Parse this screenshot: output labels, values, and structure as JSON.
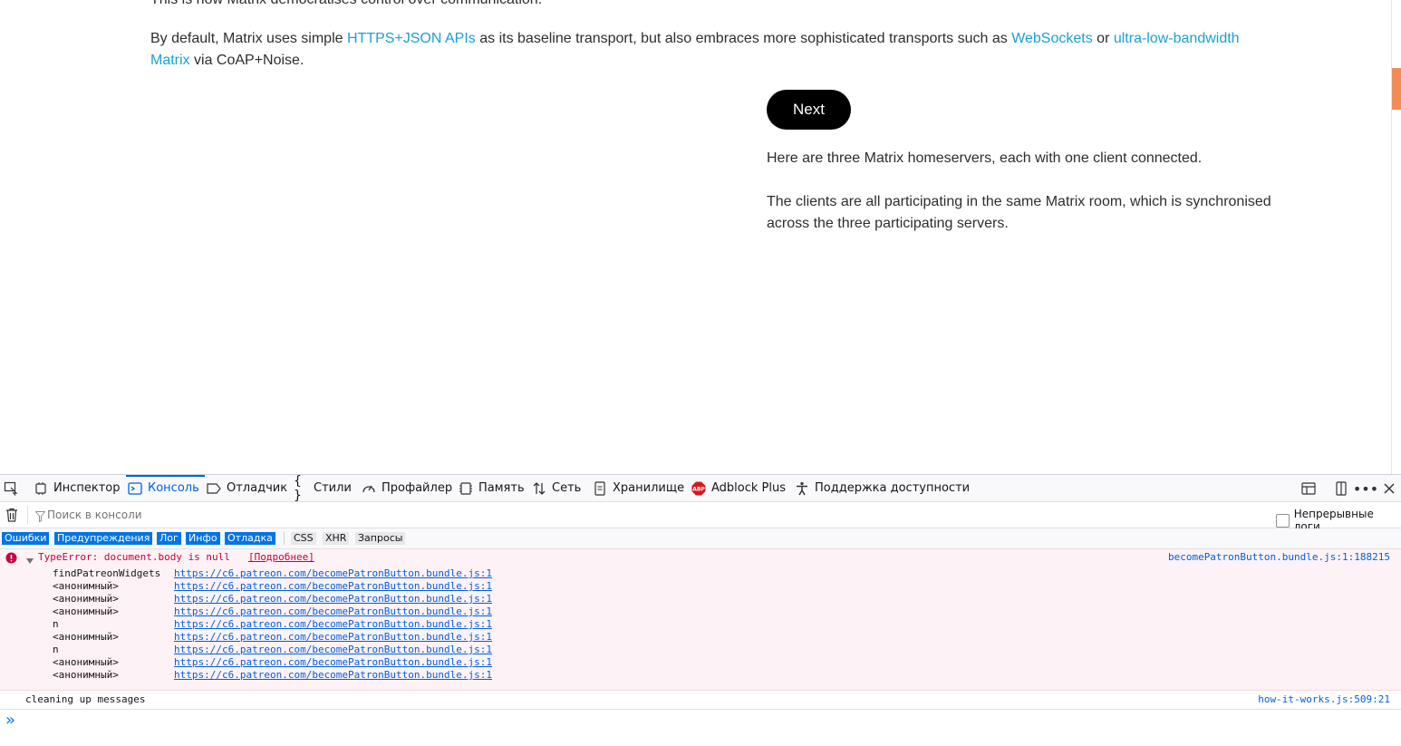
{
  "page": {
    "top_text": "This is how Matrix democratises control over communication.",
    "para1": {
      "t1": "By default, Matrix uses simple ",
      "l1": "HTTPS+JSON APIs",
      "t2": " as its baseline transport, but also embraces more sophisticated transports such as ",
      "l2": "WebSockets",
      "t3": " or ",
      "l3a": "ultra-low-bandwidth",
      "l3b": "Matrix",
      "t4": " via CoAP+Noise."
    },
    "next_label": "Next",
    "desc1": "Here are three Matrix homeservers, each with one client connected.",
    "desc2a": "The clients are all participating in the same Matrix room, which is synchronised",
    "desc2b": "across the three participating servers."
  },
  "devtools": {
    "tabs": [
      {
        "label": "Инспектор",
        "icon": "inspector-icon"
      },
      {
        "label": "Консоль",
        "icon": "console-icon"
      },
      {
        "label": "Отладчик",
        "icon": "debugger-icon"
      },
      {
        "label": "Стили",
        "icon": "styles-icon"
      },
      {
        "label": "Профайлер",
        "icon": "profiler-icon"
      },
      {
        "label": "Память",
        "icon": "memory-icon"
      },
      {
        "label": "Сеть",
        "icon": "network-icon"
      },
      {
        "label": "Хранилище",
        "icon": "storage-icon"
      },
      {
        "label": "Adblock Plus",
        "icon": "adblock-icon"
      },
      {
        "label": "Поддержка доступности",
        "icon": "accessibility-icon"
      }
    ],
    "filter_placeholder": "Поиск в консоли",
    "persist_logs_label": "Непрерывные логи",
    "levels": [
      "Ошибки",
      "Предупреждения",
      "Лог",
      "Инфо",
      "Отладка"
    ],
    "extra_filters": [
      "CSS",
      "XHR",
      "Запросы"
    ],
    "error": {
      "message": "TypeError: document.body is null",
      "more": "[Подробнее]",
      "source": "becomePatronButton.bundle.js:1:188215",
      "stack": [
        {
          "fn": "findPatreonWidgets",
          "url": "https://c6.patreon.com/becomePatronButton.bundle.js:1"
        },
        {
          "fn": "<анонимный>",
          "url": "https://c6.patreon.com/becomePatronButton.bundle.js:1"
        },
        {
          "fn": "<анонимный>",
          "url": "https://c6.patreon.com/becomePatronButton.bundle.js:1"
        },
        {
          "fn": "<анонимный>",
          "url": "https://c6.patreon.com/becomePatronButton.bundle.js:1"
        },
        {
          "fn": "n",
          "url": "https://c6.patreon.com/becomePatronButton.bundle.js:1"
        },
        {
          "fn": "<анонимный>",
          "url": "https://c6.patreon.com/becomePatronButton.bundle.js:1"
        },
        {
          "fn": "n",
          "url": "https://c6.patreon.com/becomePatronButton.bundle.js:1"
        },
        {
          "fn": "<анонимный>",
          "url": "https://c6.patreon.com/becomePatronButton.bundle.js:1"
        },
        {
          "fn": "<анонимный>",
          "url": "https://c6.patreon.com/becomePatronButton.bundle.js:1"
        }
      ]
    },
    "log": {
      "message": "cleaning up messages",
      "source": "how-it-works.js:509:21"
    },
    "prompt": "»"
  },
  "colors": {
    "link": "#1aa0d3",
    "accent": "#0061e0",
    "error_bg": "#fdf2f5",
    "error_text": "#c50042",
    "scroll_thumb": "#f28c56"
  }
}
